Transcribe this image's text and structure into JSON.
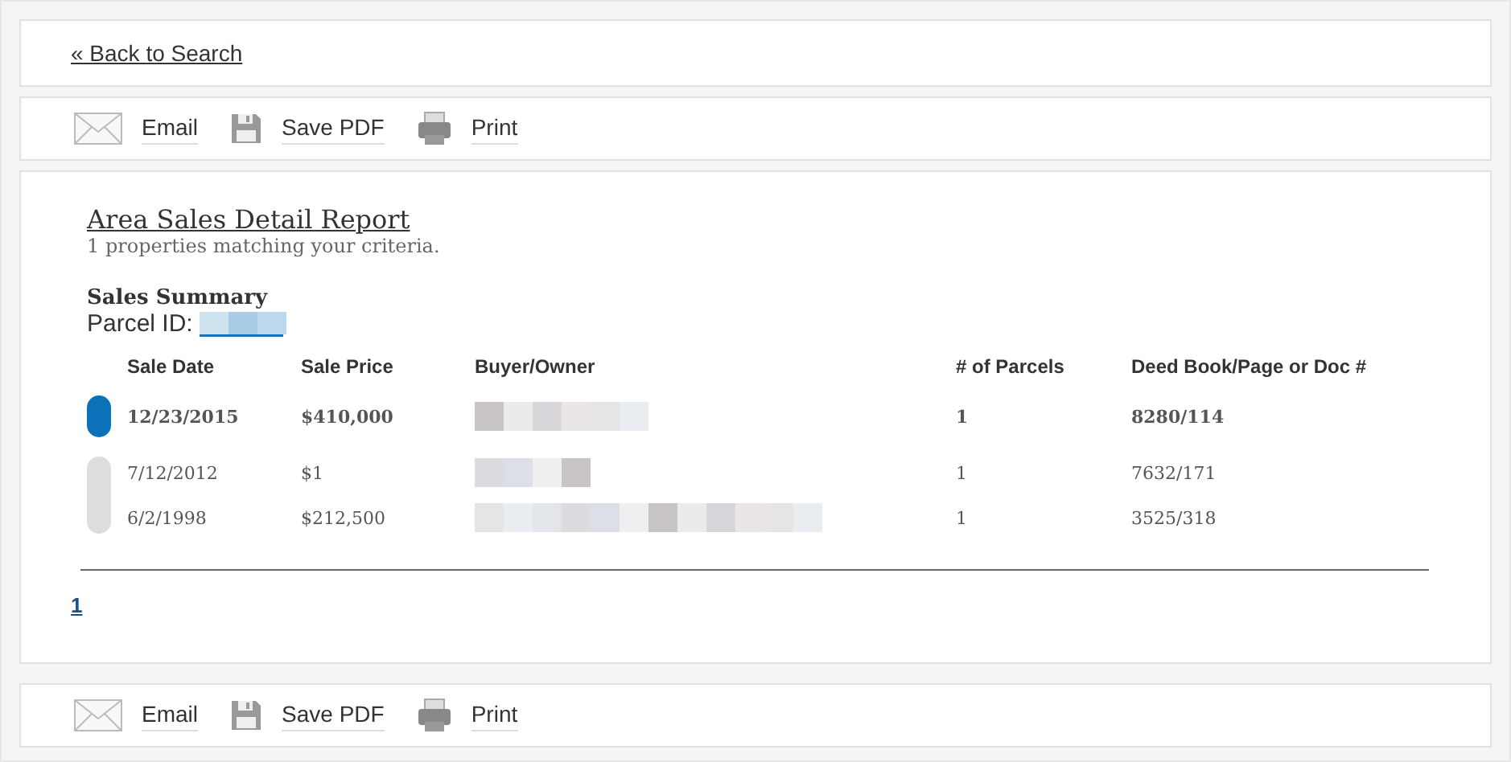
{
  "back_link": "« Back to Search",
  "toolbar_top": [
    {
      "kind": "email",
      "label": "Email"
    },
    {
      "kind": "pdf",
      "label": "Save PDF"
    },
    {
      "kind": "print",
      "label": "Print"
    }
  ],
  "report": {
    "title": "Area Sales Detail Report",
    "subtitle": "1 properties matching your criteria.",
    "section": "Sales Summary",
    "parcel_label": "Parcel ID:",
    "columns": [
      "Sale Date",
      "Sale Price",
      "Buyer/Owner",
      "# of Parcels",
      "Deed Book/Page or Doc #"
    ],
    "groups": [
      {
        "selected": true,
        "rows": [
          {
            "date": "12/23/2015",
            "price": "$410,000",
            "parcels": "1",
            "deed": "8280/114"
          }
        ]
      },
      {
        "selected": false,
        "rows": [
          {
            "date": "7/12/2012",
            "price": "$1",
            "parcels": "1",
            "deed": "7632/171"
          },
          {
            "date": "6/2/1998",
            "price": "$212,500",
            "parcels": "1",
            "deed": "3525/318"
          }
        ]
      }
    ],
    "pages": [
      "1"
    ]
  },
  "toolbar_bottom": [
    {
      "kind": "email",
      "label": "Email"
    },
    {
      "kind": "pdf",
      "label": "Save PDF"
    },
    {
      "kind": "print",
      "label": "Print"
    }
  ]
}
